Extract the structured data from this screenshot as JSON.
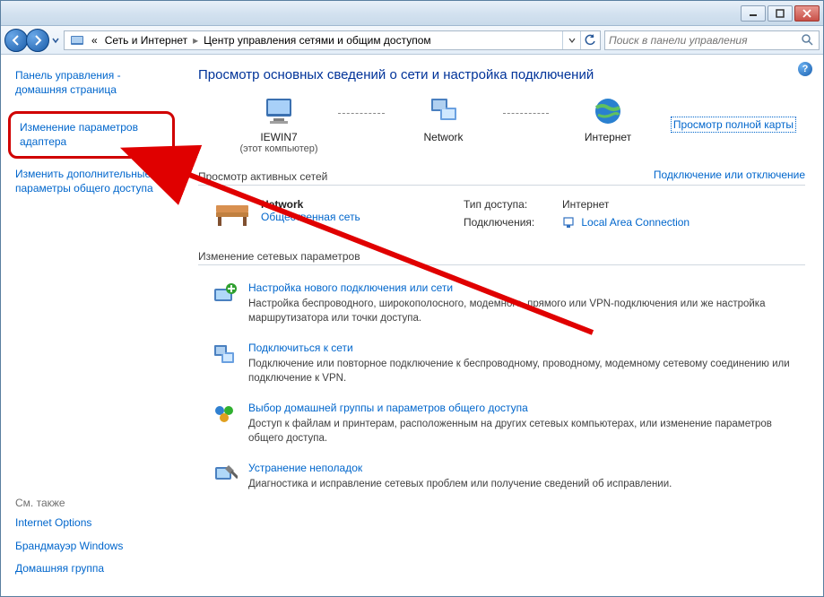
{
  "titlebar": {},
  "address": {
    "prefix": "«",
    "seg1": "Сеть и Интернет",
    "seg2": "Центр управления сетями и общим доступом"
  },
  "search": {
    "placeholder": "Поиск в панели управления"
  },
  "sidebar": {
    "home": "Панель управления - домашняя страница",
    "adapter": "Изменение параметров адаптера",
    "sharing": "Изменить дополнительные параметры общего доступа",
    "seealso_title": "См. также",
    "seealso": {
      "internet_options": "Internet Options",
      "firewall": "Брандмауэр Windows",
      "homegroup": "Домашняя группа"
    }
  },
  "content": {
    "title": "Просмотр основных сведений о сети и настройка подключений",
    "map": {
      "computer_name": "IEWIN7",
      "computer_sub": "(этот компьютер)",
      "network": "Network",
      "internet": "Интернет",
      "fullmap": "Просмотр полной карты"
    },
    "active_section_title": "Просмотр активных сетей",
    "active_section_link": "Подключение или отключение",
    "active_net": {
      "name": "Network",
      "type": "Общественная сеть",
      "access_label": "Тип доступа:",
      "access_value": "Интернет",
      "conn_label": "Подключения:",
      "conn_value": "Local Area Connection"
    },
    "change_section_title": "Изменение сетевых параметров",
    "actions": [
      {
        "title": "Настройка нового подключения или сети",
        "desc": "Настройка беспроводного, широкополосного, модемного, прямого или VPN-подключения или же настройка маршрутизатора или точки доступа."
      },
      {
        "title": "Подключиться к сети",
        "desc": "Подключение или повторное подключение к беспроводному, проводному, модемному сетевому соединению или подключение к VPN."
      },
      {
        "title": "Выбор домашней группы и параметров общего доступа",
        "desc": "Доступ к файлам и принтерам, расположенным на других сетевых компьютерах, или изменение параметров общего доступа."
      },
      {
        "title": "Устранение неполадок",
        "desc": "Диагностика и исправление сетевых проблем или получение сведений об исправлении."
      }
    ]
  }
}
